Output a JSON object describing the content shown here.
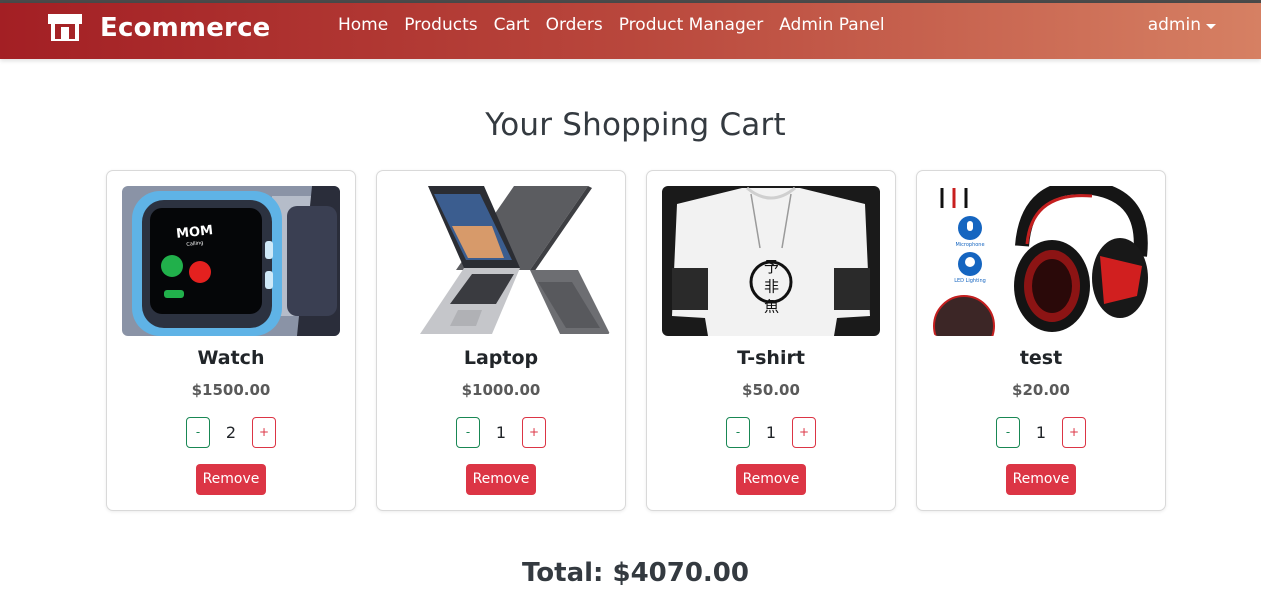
{
  "navbar": {
    "brand": "Ecommerce",
    "brand_icon": "storefront-icon",
    "links": [
      "Home",
      "Products",
      "Cart",
      "Orders",
      "Product Manager",
      "Admin Panel"
    ],
    "user": "admin",
    "gradient": [
      "#a31f24",
      "#d68063"
    ]
  },
  "page_title": "Your Shopping Cart",
  "cart": {
    "items": [
      {
        "name": "Watch",
        "price": "$1500.00",
        "qty": "2",
        "minus": "-",
        "plus": "+",
        "remove": "Remove",
        "image": "smartwatch-image"
      },
      {
        "name": "Laptop",
        "price": "$1000.00",
        "qty": "1",
        "minus": "-",
        "plus": "+",
        "remove": "Remove",
        "image": "laptop-image"
      },
      {
        "name": "T-shirt",
        "price": "$50.00",
        "qty": "1",
        "minus": "-",
        "plus": "+",
        "remove": "Remove",
        "image": "tshirt-image"
      },
      {
        "name": "test",
        "price": "$20.00",
        "qty": "1",
        "minus": "-",
        "plus": "+",
        "remove": "Remove",
        "image": "headphones-image"
      }
    ],
    "image_text": {
      "watch_caller": "MOM",
      "watch_status": "Calling",
      "tshirt_print": "予 非 魚",
      "headset_mic": "Microphone",
      "headset_led": "LED Lighting"
    }
  },
  "total": "Total: $4070.00",
  "colors": {
    "danger": "#dc3545",
    "success": "#198754"
  }
}
